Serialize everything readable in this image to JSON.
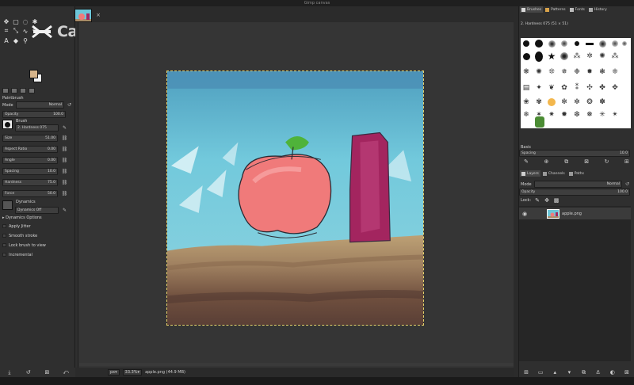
{
  "window": {
    "title": "Gimp canvas"
  },
  "watermark": {
    "text": "CapCut"
  },
  "image_tab": {
    "close_label": "×"
  },
  "toolbox": {
    "tool_icons": [
      "move-icon",
      "rect-select-icon",
      "lasso-icon",
      "fuzzy-select-icon",
      "crop-icon",
      "transform-icon",
      "warp-icon",
      "paths-icon",
      "text-icon",
      "fill-icon",
      "zoom-icon"
    ],
    "colors": {
      "foreground": "#d6b48a",
      "background": "#f5f5f5"
    }
  },
  "tool_options": {
    "title": "Paintbrush",
    "mode_label": "Mode",
    "mode_value": "Normal",
    "opacity_label": "Opacity",
    "opacity_value": "100.0",
    "brush_label": "Brush",
    "brush_name": "2. Hardness 075",
    "size_label": "Size",
    "size_value": "51.00",
    "aspect_label": "Aspect Ratio",
    "aspect_value": "0.00",
    "angle_label": "Angle",
    "angle_value": "0.00",
    "spacing_label": "Spacing",
    "spacing_value": "10.0",
    "hardness_label": "Hardness",
    "hardness_value": "75.0",
    "force_label": "Force",
    "force_value": "50.0",
    "dynamics_label": "Dynamics",
    "dynamics_value": "Dynamics Off",
    "dynamics_options_label": "Dynamics Options",
    "checks": [
      "Apply Jitter",
      "Smooth stroke",
      "Lock brush to view",
      "Incremental"
    ]
  },
  "statusbar": {
    "unit": "px",
    "zoom": "33.3%",
    "file_info": "apple.png (44.9 MB)"
  },
  "dock": {
    "tabs": [
      "Brushes",
      "Patterns",
      "Fonts",
      "History"
    ],
    "brush_name": "2. Hardness 075 (51 × 51)",
    "brush_tag": "Basic",
    "spacing_label": "Spacing",
    "spacing_value": "10.0",
    "layer_tabs": [
      "Layers",
      "Channels",
      "Paths"
    ],
    "mode_label": "Mode",
    "mode_value": "Normal",
    "opacity_label": "Opacity",
    "opacity_value": "100.0",
    "lock_label": "Lock:",
    "layer_name": "apple.png"
  },
  "canvas_colors": {
    "sky": "#6cc6d9",
    "apple": "#f07a7a",
    "leaf": "#4fb33a",
    "bottle": "#a3255f",
    "ground_top": "#b89b72",
    "ground_bottom": "#6e4f3b"
  }
}
